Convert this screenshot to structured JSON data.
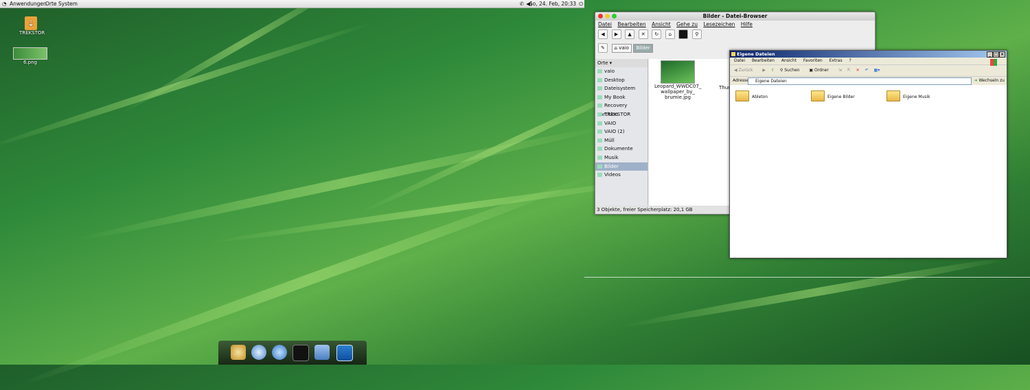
{
  "top_panel": {
    "menus": [
      "Anwendungen",
      "Orte",
      "System"
    ],
    "clock": "So, 24. Feb, 20:33"
  },
  "desktop_icons": [
    {
      "label": "TREKSTOR"
    },
    {
      "label": "6.png"
    }
  ],
  "file_browser": {
    "title": "Bilder - Datei-Browser",
    "menu": [
      "Datei",
      "Bearbeiten",
      "Ansicht",
      "Gehe zu",
      "Lesezeichen",
      "Hilfe"
    ],
    "path": [
      "vaio",
      "Bilder"
    ],
    "sidebar_header": "Orte ▾",
    "places": [
      "vaio",
      "Desktop",
      "Dateisystem",
      "My Book",
      "Recovery Partition",
      "TREKSTOR",
      "VAIO",
      "VAIO (2)",
      "Müll",
      "Dokumente",
      "Musik",
      "Bilder",
      "Videos"
    ],
    "selected_place": "Bilder",
    "file_name_1": "Leopard_WWDC07_",
    "file_name_2": "wallpaper_by_",
    "file_name_3": "brumie.jpg",
    "partial_file": "Thur",
    "status": "3 Objekte, freier Speicherplatz: 20,1 GB"
  },
  "explorer": {
    "title": "Eigene Dateien",
    "menu": [
      "Datei",
      "Bearbeiten",
      "Ansicht",
      "Favoriten",
      "Extras",
      "?"
    ],
    "toolbar": [
      "Zurück",
      "Suchen",
      "Ordner"
    ],
    "address_label": "Adresse",
    "address_value": "Eigene Dateien",
    "go_label": "Wechseln zu",
    "items": [
      "Ableton",
      "Eigene Bilder",
      "Eigene Musik"
    ]
  },
  "dock": {
    "icons": [
      "browser-icon",
      "music-icon",
      "chat-icon",
      "terminal-icon",
      "folder-icon",
      "monitor-icon"
    ]
  }
}
